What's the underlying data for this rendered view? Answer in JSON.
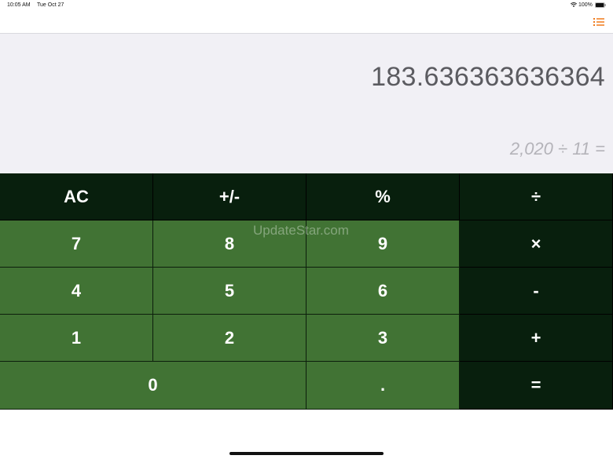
{
  "status_bar": {
    "time": "10:05 AM",
    "date": "Tue Oct 27",
    "battery": "100%",
    "icons": [
      "wifi-icon",
      "battery-icon"
    ]
  },
  "nav": {
    "history_icon": "list-icon",
    "accent_color": "#f07a1a"
  },
  "display": {
    "result": "183.636363636364",
    "expression": "2,020 ÷ 11  ="
  },
  "keypad": {
    "row1": [
      "AC",
      "+/-",
      "%",
      "÷"
    ],
    "row2": [
      "7",
      "8",
      "9",
      "×"
    ],
    "row3": [
      "4",
      "5",
      "6",
      "-"
    ],
    "row4": [
      "1",
      "2",
      "3",
      "+"
    ],
    "row5": [
      "0",
      ".",
      "="
    ]
  },
  "watermark": "UpdateStar.com",
  "colors": {
    "key_dark": "#081f0d",
    "key_green": "#417334",
    "display_bg": "#f1f0f5"
  }
}
